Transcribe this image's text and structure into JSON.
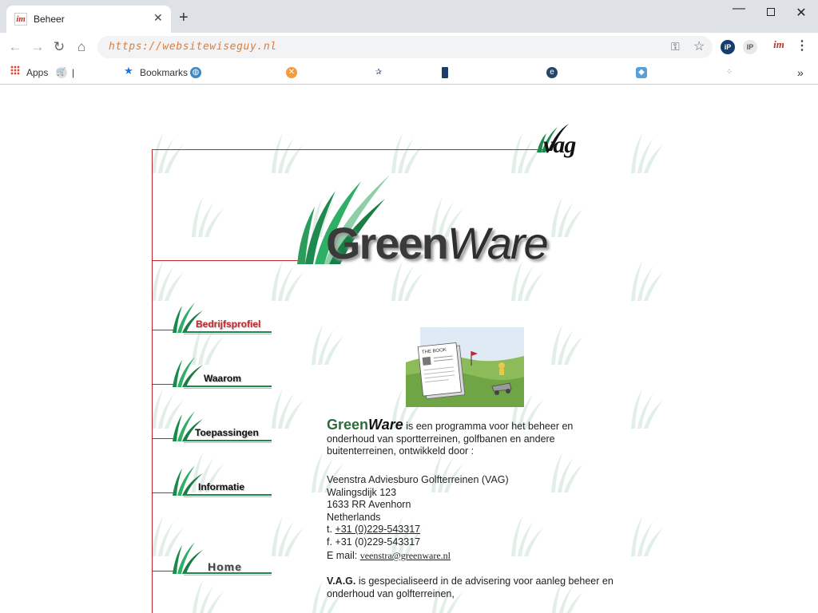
{
  "browser": {
    "tab_title": "Beheer",
    "tab_favicon": "im",
    "url": "https://websitewiseguy.nl",
    "bookmarks": {
      "apps_label": "Apps",
      "bookmarks_label": "Bookmarks",
      "overflow": "»"
    },
    "extensions": {
      "ip_label": "iP",
      "ip2_label": "IP",
      "im_label": "im"
    }
  },
  "site": {
    "vag_logo": "vag",
    "logo": {
      "green": "Green",
      "ware": "Ware"
    },
    "nav": [
      {
        "label": "Bedrijfsprofiel",
        "active": true
      },
      {
        "label": "Waarom",
        "active": false
      },
      {
        "label": "Toepassingen",
        "active": false
      },
      {
        "label": "Informatie",
        "active": false
      },
      {
        "label": "Home",
        "active": false
      }
    ],
    "illustration_caption": "THE BOOK",
    "intro": {
      "brand_green": "Green",
      "brand_ware": "Ware",
      "text": " is een programma voor het beheer en onderhoud van sportterreinen, golfbanen en andere buitenterreinen, ontwikkeld door :"
    },
    "address": {
      "company": "Veenstra Adviesburo Golfterreinen (VAG)",
      "street": "Walingsdijk 123",
      "city": "1633 RR Avenhorn",
      "country": "Netherlands",
      "phone_prefix": "t. ",
      "phone": "+31 (0)229-543317",
      "fax": "f. +31 (0)229-543317",
      "email_label": "E mail: ",
      "email": "veenstra@greenware.nl"
    },
    "vag_note": {
      "abbr": "V.A.G.",
      "text": " is gespecialiseerd in de advisering voor aanleg beheer en onderhoud van golfterreinen,"
    }
  },
  "colors": {
    "accent_red": "#c0262b",
    "grass_green": "#1a8a4a",
    "url_orange": "#e07b39"
  }
}
